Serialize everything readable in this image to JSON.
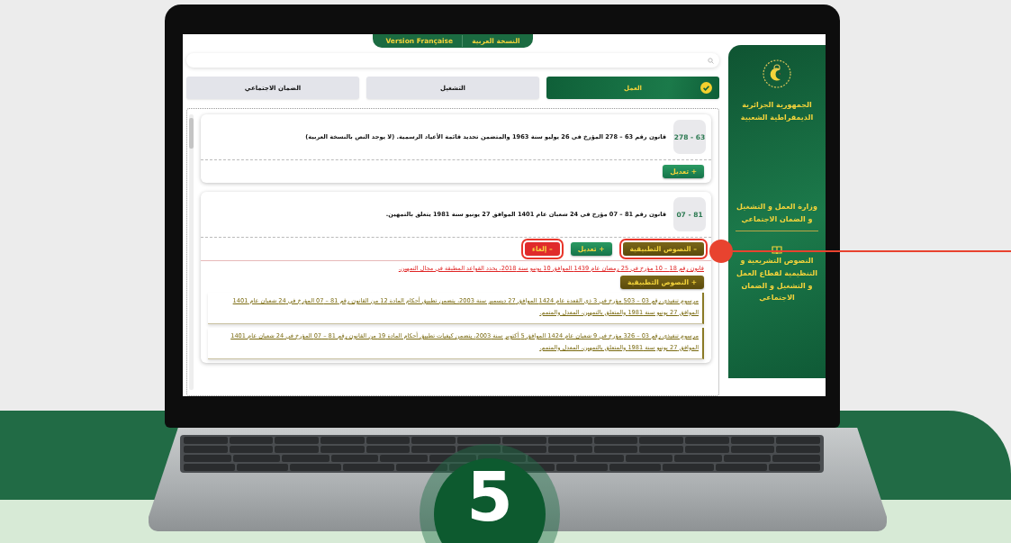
{
  "language_switch": [
    {
      "label": "النسخة العربية"
    },
    {
      "label": "Version Française"
    }
  ],
  "tabs": [
    {
      "label": "العمل",
      "selected": true
    },
    {
      "label": "التشغيل",
      "selected": false
    },
    {
      "label": "الضمان الاجتماعي",
      "selected": false
    }
  ],
  "sidebar": {
    "republic": "الجمهورية الجزائرية الديمقراطية الشعبية",
    "ministry": "وزارة العمل و التشغيل و الضمان الاجتماعي",
    "section_title": "النصوص التشريعية و التنظيمية لقطاع العمل و التشغيل و الضمان الاجتماعي"
  },
  "laws": [
    {
      "number": "278 - 63",
      "title": "قانون رقم 63 – 278 المؤرخ في 26 يوليو سنة 1963 والمتضمن تحديد قائمة الأعياد الرسمية. (لا يوجد النص بالنسخة العربية)",
      "buttons": [
        {
          "kind": "amend",
          "label": "+ تعديل",
          "highlighted": false
        }
      ]
    },
    {
      "number": "07 - 81",
      "title": "قانون رقم 81 – 07 مؤرخ في 24 شعبان عام 1401 الموافق 27 يونيو سنة 1981 يتعلق بالتمهين.",
      "buttons": [
        {
          "kind": "implementing",
          "label": "– النصوص التطبيقية",
          "highlighted": true
        },
        {
          "kind": "amend",
          "label": "+ تعديل",
          "highlighted": false
        },
        {
          "kind": "repeal",
          "label": "– إلغاء",
          "highlighted": true
        }
      ],
      "details": [
        {
          "kind": "repealing_law",
          "text": "قانون رقم 18 – 10 مؤرخ في 25 رمضان عام 1439 الموافق 10 يونيو سنة 2018، يحدد القواعد المطبقة في مجال التمهين.",
          "button": "+ النصوص التطبيقية"
        },
        {
          "kind": "decree",
          "text": "مرسوم تنفيذي رقم 03 – 503 مؤرخ في 3 ذي القعدة عام 1424 الموافق 27 ديسمبر سنة 2003، يتضمن تطبيق أحكام المادة 12 من القانون رقم 81 – 07 المؤرخ في 24 شعبان عام 1401 الموافق 27 يونيو سنة 1981 والمتعلق بالتمهين، المعدل والمتمم."
        },
        {
          "kind": "decree",
          "text": "مرسوم تنفيذي رقم 03 – 326 مؤرخ في 9 شعبان عام 1424 الموافق 5 أكتوبر سنة 2003، يتضمن كيفيات تطبيق أحكام المادة 19 من القانون رقم 81 – 07 المؤرخ في 24 شعبان عام 1401 الموافق 27 يونيو سنة 1981 والمتعلق بالتمهين، المعدل والمتمم."
        }
      ]
    }
  ],
  "step_number": "5"
}
